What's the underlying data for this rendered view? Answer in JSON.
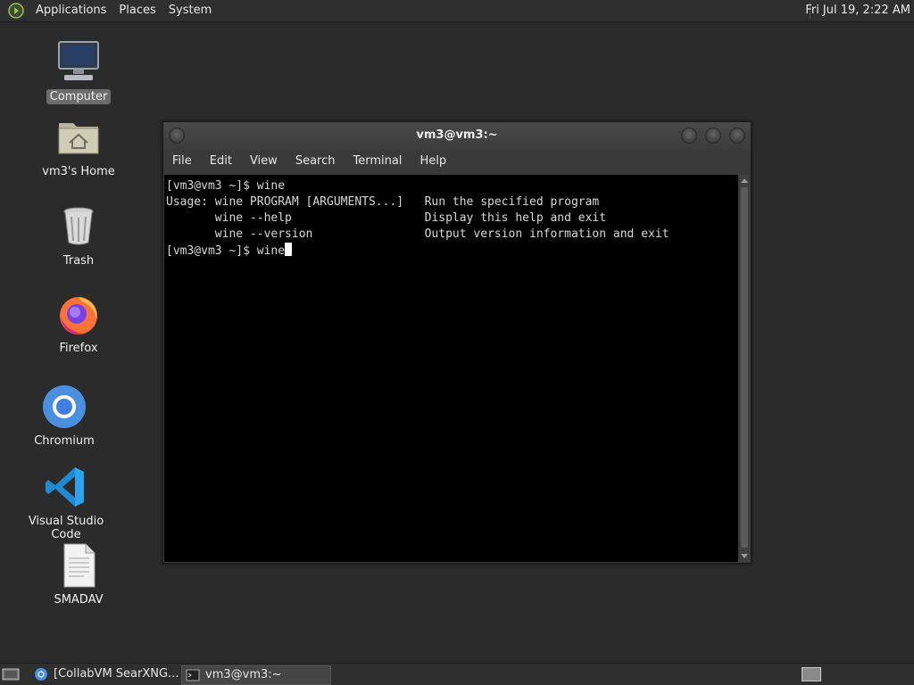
{
  "top_panel": {
    "menus": [
      "Applications",
      "Places",
      "System"
    ],
    "clock": "Fri Jul 19,  2:22 AM"
  },
  "desktop": {
    "icons": [
      {
        "label": "Computer",
        "icon": "computer-icon"
      },
      {
        "label": "vm3's Home",
        "icon": "home-folder-icon"
      },
      {
        "label": "Trash",
        "icon": "trash-icon"
      },
      {
        "label": "Firefox",
        "icon": "firefox-icon"
      },
      {
        "label": "Chromium",
        "icon": "chromium-icon"
      },
      {
        "label": "Visual Studio Code",
        "icon": "vscode-icon"
      },
      {
        "label": "SMADAV",
        "icon": "document-icon"
      }
    ]
  },
  "terminal": {
    "title": "vm3@vm3:~",
    "menu": [
      "File",
      "Edit",
      "View",
      "Search",
      "Terminal",
      "Help"
    ],
    "lines": [
      "[vm3@vm3 ~]$ wine",
      "Usage: wine PROGRAM [ARGUMENTS...]   Run the specified program",
      "       wine --help                   Display this help and exit",
      "       wine --version                Output version information and exit"
    ],
    "prompt": "[vm3@vm3 ~]$ ",
    "current_input": "wine"
  },
  "taskbar": {
    "tasks": [
      {
        "label": "[CollabVM SearXNG...",
        "icon": "chromium-icon"
      },
      {
        "label": "vm3@vm3:~",
        "icon": "terminal-icon"
      }
    ]
  },
  "colors": {
    "desktop_bg": "#2b2b2b",
    "panel_bg": "#2f2f2f",
    "terminal_bg": "#000000",
    "terminal_fg": "#d8d8d8"
  }
}
